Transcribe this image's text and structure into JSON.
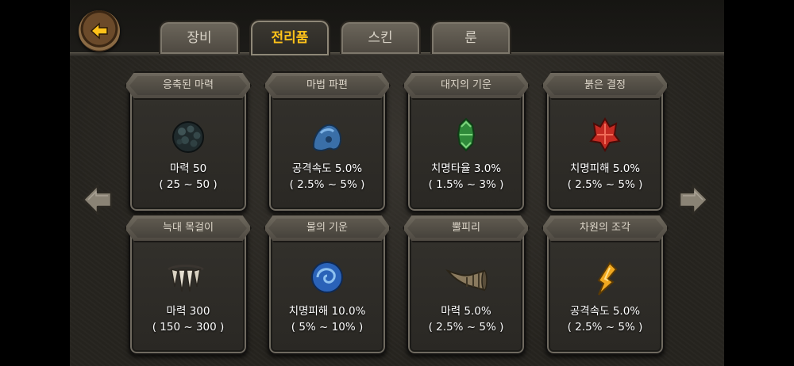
{
  "tabs": [
    {
      "label": "장비",
      "active": false
    },
    {
      "label": "전리품",
      "active": true
    },
    {
      "label": "스킨",
      "active": false
    },
    {
      "label": "룬",
      "active": false
    }
  ],
  "colors": {
    "active_tab_text": "#ffc21a",
    "tab_text": "#d8d2c6"
  },
  "cards": [
    {
      "title": "응축된 마력",
      "stat": "마력 50",
      "range": "( 25 ~ 50 )",
      "icon": "dark-orb-icon"
    },
    {
      "title": "마법 파편",
      "stat": "공격속도 5.0%",
      "range": "( 2.5% ~ 5% )",
      "icon": "blue-fragment-icon"
    },
    {
      "title": "대지의 기운",
      "stat": "치명타율 3.0%",
      "range": "( 1.5% ~ 3% )",
      "icon": "green-crystal-icon"
    },
    {
      "title": "붉은 결정",
      "stat": "치명피해 5.0%",
      "range": "( 2.5% ~ 5% )",
      "icon": "red-crystal-icon"
    },
    {
      "title": "늑대 목걸이",
      "stat": "마력 300",
      "range": "( 150 ~ 300 )",
      "icon": "wolf-fang-necklace-icon"
    },
    {
      "title": "물의 기운",
      "stat": "치명피해 10.0%",
      "range": "( 5% ~ 10% )",
      "icon": "water-orb-icon"
    },
    {
      "title": "뿔피리",
      "stat": "마력 5.0%",
      "range": "( 2.5% ~ 5% )",
      "icon": "horn-icon"
    },
    {
      "title": "차원의 조각",
      "stat": "공격속도 5.0%",
      "range": "( 2.5% ~ 5% )",
      "icon": "gold-shard-icon"
    }
  ]
}
